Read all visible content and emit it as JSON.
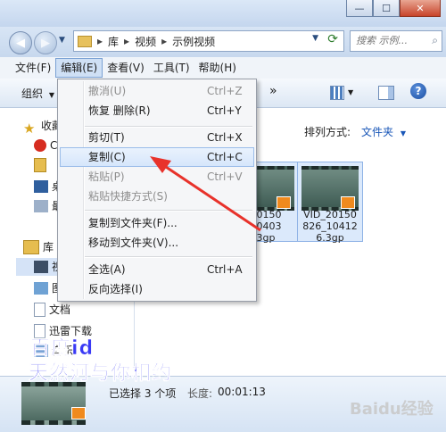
{
  "window": {
    "minimize_glyph": "—",
    "maximize_glyph": "☐",
    "close_glyph": "✕"
  },
  "nav": {
    "breadcrumb": [
      "库",
      "视频",
      "示例视频"
    ],
    "search_placeholder": "搜索 示例..."
  },
  "menubar": {
    "items": [
      "文件(F)",
      "编辑(E)",
      "查看(V)",
      "工具(T)",
      "帮助(H)"
    ]
  },
  "toolbar": {
    "organize_label": "组织",
    "more_label": "»"
  },
  "edit_menu": {
    "items": [
      {
        "label": "撤消(U)",
        "shortcut": "Ctrl+Z",
        "disabled": true
      },
      {
        "label": "恢复 删除(R)",
        "shortcut": "Ctrl+Y",
        "disabled": false
      },
      {
        "label": "剪切(T)",
        "shortcut": "Ctrl+X",
        "disabled": false
      },
      {
        "label": "复制(C)",
        "shortcut": "Ctrl+C",
        "disabled": false
      },
      {
        "label": "粘贴(P)",
        "shortcut": "Ctrl+V",
        "disabled": true
      },
      {
        "label": "粘贴快捷方式(S)",
        "shortcut": "",
        "disabled": true
      },
      {
        "label": "复制到文件夹(F)...",
        "shortcut": "",
        "disabled": false
      },
      {
        "label": "移动到文件夹(V)...",
        "shortcut": "",
        "disabled": false
      },
      {
        "label": "全选(A)",
        "shortcut": "Ctrl+A",
        "disabled": false
      },
      {
        "label": "反向选择(I)",
        "shortcut": "",
        "disabled": false
      }
    ]
  },
  "navpane": {
    "favorites_label": "收藏",
    "items_partial": [
      "C",
      "",
      "桌",
      "最"
    ],
    "library_label": "库",
    "library_items_partial": [
      "视",
      "图"
    ],
    "docs_label": "文档",
    "xunlei_label": "迅雷下载",
    "music_label": "音乐"
  },
  "content": {
    "arrange_label": "排列方式:",
    "arrange_value": "文件夹",
    "thumbs": [
      {
        "caption_line1": "20150",
        "caption_line2": "10403",
        "caption_line3": "3gp"
      },
      {
        "caption_line1": "VID_20150",
        "caption_line2": "826_10412",
        "caption_line3": "6.3gp"
      }
    ]
  },
  "status": {
    "selection_text": "已选择 3 个项",
    "length_label": "长度:",
    "length_value": "00:01:13"
  },
  "watermark": {
    "line1": "百度id",
    "line2": "天然河与你相约",
    "brand": "Baidu经验"
  },
  "colors": {
    "accent_arrow": "#e8322b",
    "watermark_text": "#3a3af5"
  }
}
